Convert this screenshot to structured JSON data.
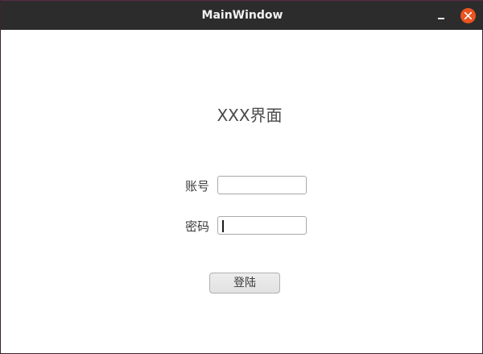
{
  "window": {
    "title": "MainWindow"
  },
  "main": {
    "heading": "XXX界面",
    "account_label": "账号",
    "account_value": "",
    "password_label": "密码",
    "password_value": "",
    "login_label": "登陆"
  },
  "colors": {
    "titlebar_bg": "#2c2c2c",
    "close_button": "#e95420",
    "window_bg": "#ffffff"
  },
  "icons": {
    "minimize": "minimize-icon",
    "close": "close-icon"
  }
}
